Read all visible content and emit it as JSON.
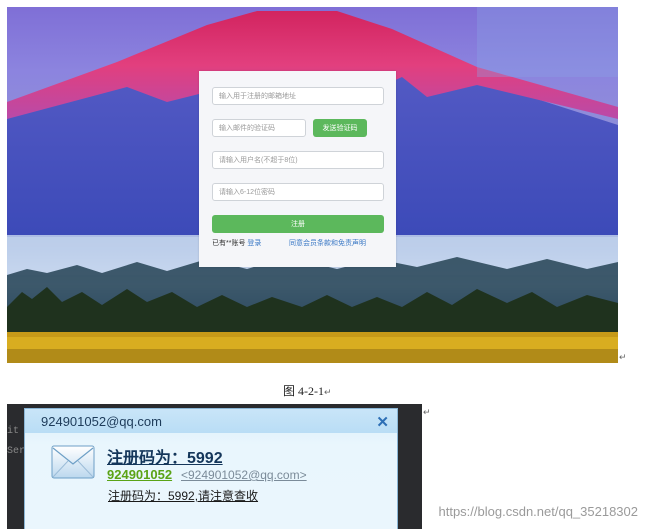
{
  "register_form": {
    "email_placeholder": "输入用于注册的邮箱地址",
    "code_placeholder": "输入邮件的验证码",
    "send_code_label": "发送验证码",
    "username_placeholder": "请输入用户名(不超于8位)",
    "password_placeholder": "请输入6-12位密码",
    "submit_label": "注册",
    "have_account_text": "已有**账号",
    "login_link": "登录",
    "terms_link": "同意会员条款和免责声明"
  },
  "caption": "图 4-2-1",
  "paragraph_mark": "↵",
  "notification": {
    "sender": "924901052@qq.com",
    "close_glyph": "✕",
    "title": "注册码为：5992",
    "qq_number": "924901052",
    "email": "<924901052@qq.com>",
    "body": "注册码为：5992,请注意查收"
  },
  "background_code": [
    "it",
    "Ser"
  ],
  "watermark": "https://blog.csdn.net/qq_35218302",
  "colors": {
    "accent_green": "#5cb85c",
    "link_blue": "#3a78c5",
    "qq_green": "#5aa316"
  }
}
